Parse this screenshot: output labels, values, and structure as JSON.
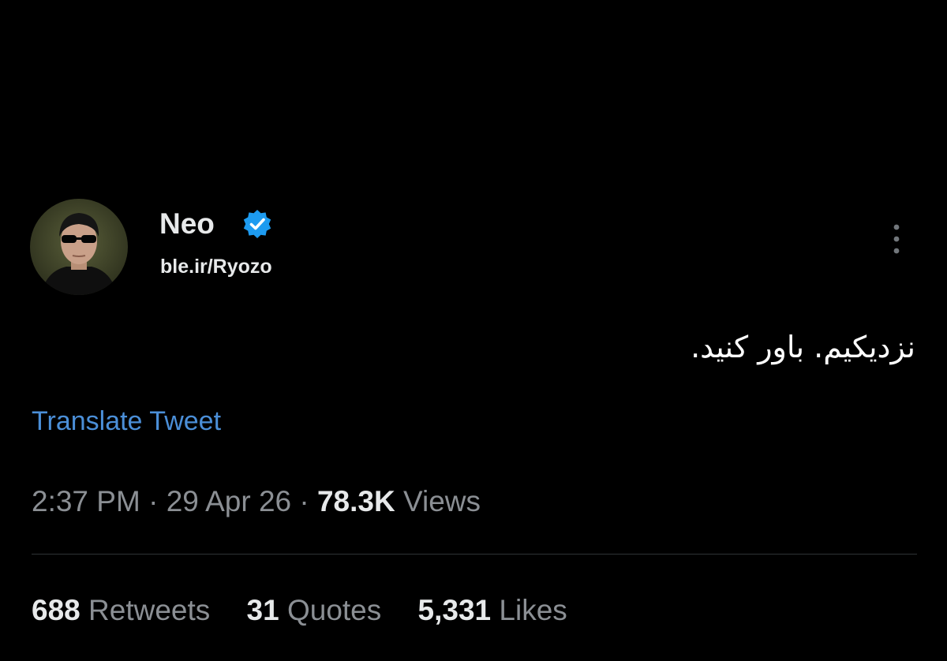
{
  "tweet": {
    "author": {
      "display_name": "Neo",
      "handle": "ble.ir/Ryozo",
      "verified": true,
      "avatar_icon": "user-avatar"
    },
    "text": "نزدیکیم. باور کنید.",
    "translate_label": "Translate Tweet",
    "time": "2:37 PM",
    "separator": "·",
    "date": "29 Apr 26",
    "views_count": "78.3K",
    "views_label": "Views",
    "stats": {
      "retweets_count": "688",
      "retweets_label": "Retweets",
      "quotes_count": "31",
      "quotes_label": "Quotes",
      "likes_count": "5,331",
      "likes_label": "Likes"
    }
  },
  "colors": {
    "background": "#000000",
    "primary_text": "#e7e9ea",
    "secondary_text": "#8b8f94",
    "link": "#4b8fd8",
    "verified_badge": "#1d9bf0",
    "divider": "#2f3336"
  },
  "icons": {
    "verified": "verified-badge-icon",
    "more": "more-vertical-icon"
  }
}
